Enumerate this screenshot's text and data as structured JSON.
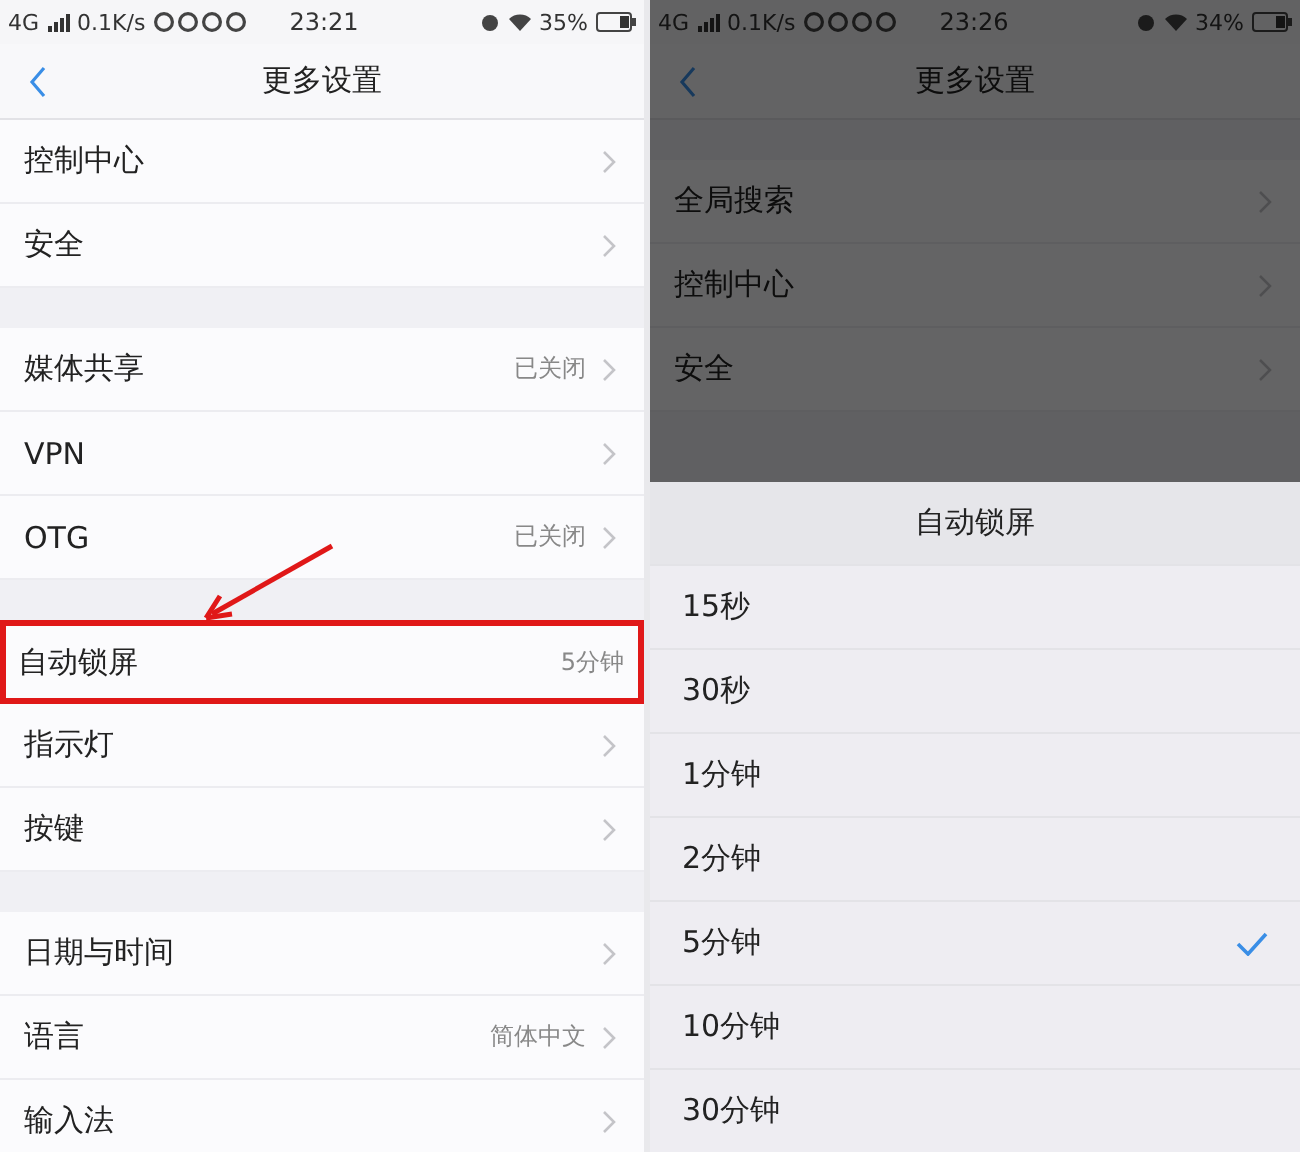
{
  "screens": [
    {
      "dimmed": false,
      "top_gap": false,
      "status_bar": {
        "network": "4G",
        "speed": "0.1K/s",
        "time": "23:21",
        "battery": "35%"
      },
      "title": "更多设置",
      "sections": [
        [
          {
            "label": "控制中心",
            "chevron": true,
            "highlighted": false
          },
          {
            "label": "安全",
            "chevron": true,
            "highlighted": false
          }
        ],
        [
          {
            "label": "媒体共享",
            "value": "已关闭",
            "chevron": true,
            "highlighted": false
          },
          {
            "label": "VPN",
            "chevron": true,
            "highlighted": false
          },
          {
            "label": "OTG",
            "value": "已关闭",
            "chevron": true,
            "highlighted": false
          }
        ],
        [
          {
            "label": "自动锁屏",
            "value": "5分钟",
            "chevron": false,
            "highlighted": true
          },
          {
            "label": "指示灯",
            "chevron": true,
            "highlighted": false
          },
          {
            "label": "按键",
            "chevron": true,
            "highlighted": false
          }
        ],
        [
          {
            "label": "日期与时间",
            "chevron": true,
            "highlighted": false
          },
          {
            "label": "语言",
            "value": "简体中文",
            "chevron": true,
            "highlighted": false
          },
          {
            "label": "输入法",
            "chevron": true,
            "highlighted": false
          }
        ]
      ]
    },
    {
      "dimmed": true,
      "top_gap": true,
      "status_bar": {
        "network": "4G",
        "speed": "0.1K/s",
        "time": "23:26",
        "battery": "34%"
      },
      "title": "更多设置",
      "sections": [
        [
          {
            "label": "全局搜索",
            "chevron": true,
            "highlighted": false
          },
          {
            "label": "控制中心",
            "chevron": true,
            "highlighted": false
          },
          {
            "label": "安全",
            "chevron": true,
            "highlighted": false
          }
        ]
      ],
      "dialog": {
        "title": "自动锁屏",
        "options": [
          {
            "label": "15秒",
            "selected": false
          },
          {
            "label": "30秒",
            "selected": false
          },
          {
            "label": "1分钟",
            "selected": false
          },
          {
            "label": "2分钟",
            "selected": false
          },
          {
            "label": "5分钟",
            "selected": true
          },
          {
            "label": "10分钟",
            "selected": false
          },
          {
            "label": "30分钟",
            "selected": false
          }
        ]
      }
    }
  ]
}
